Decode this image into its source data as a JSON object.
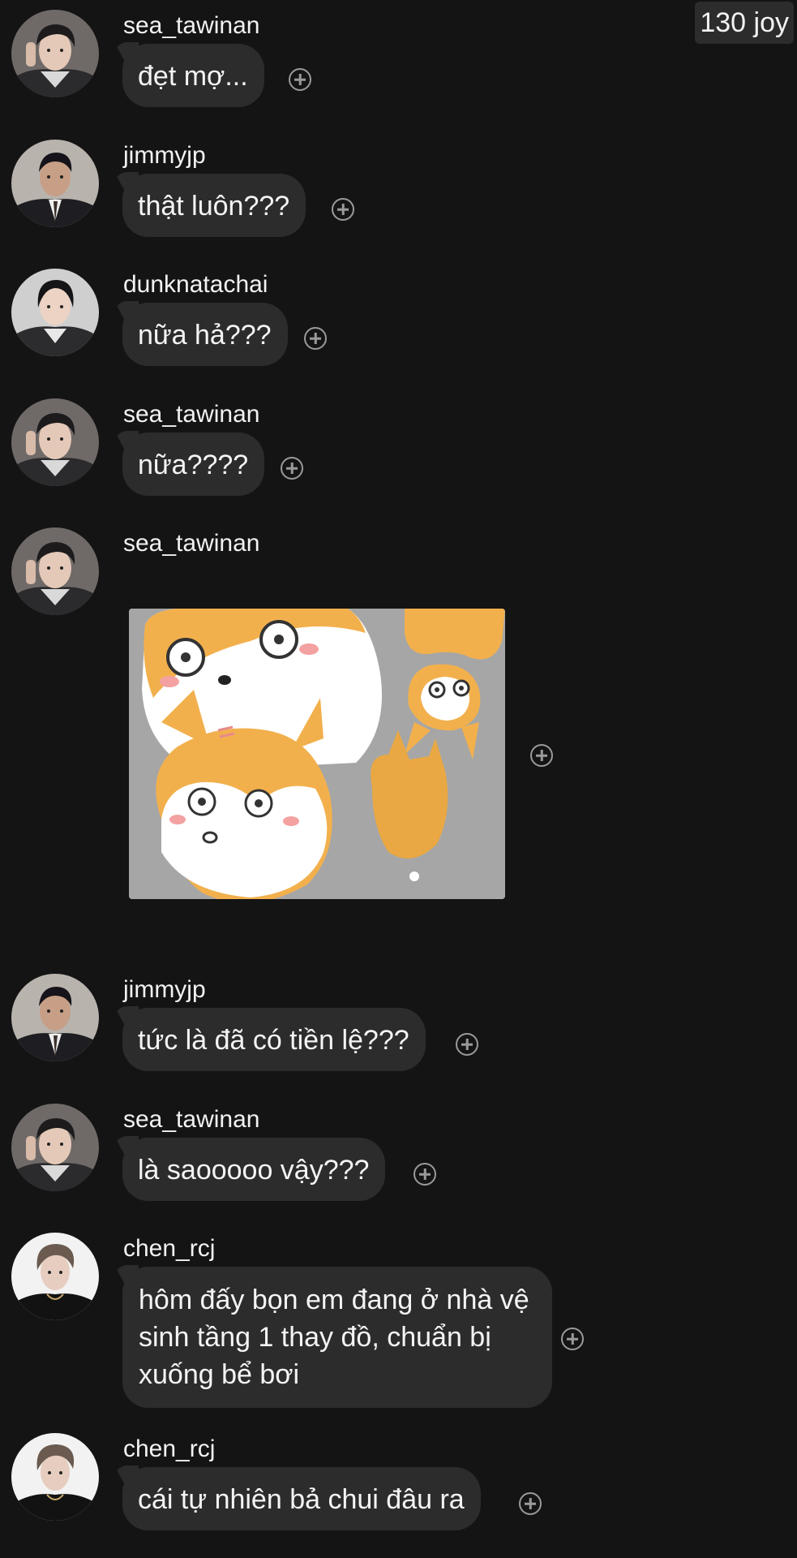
{
  "header": {
    "joy_badge": "130 joy"
  },
  "messages": [
    {
      "user": "sea_tawinan",
      "text": "đẹt mợ...",
      "avatar": "sea-avatar"
    },
    {
      "user": "jimmyjp",
      "text": "thật luôn???",
      "avatar": "jimmy-avatar"
    },
    {
      "user": "dunknatachai",
      "text": "nữa hả???",
      "avatar": "dunk-avatar"
    },
    {
      "user": "sea_tawinan",
      "text": "nữa????",
      "avatar": "sea-avatar"
    },
    {
      "user": "sea_tawinan",
      "sticker": "shiba-dogs-sticker",
      "avatar": "sea-avatar"
    },
    {
      "user": "jimmyjp",
      "text": "tức là đã có tiền lệ???",
      "avatar": "jimmy-avatar"
    },
    {
      "user": "sea_tawinan",
      "text": "là saooooo vậy???",
      "avatar": "sea-avatar"
    },
    {
      "user": "chen_rcj",
      "text": "hôm đấy bọn em đang ở nhà vệ sinh tầng 1 thay đồ, chuẩn bị xuống bể bơi",
      "avatar": "chen-avatar"
    },
    {
      "user": "chen_rcj",
      "text": "cái tự nhiên bả chui đâu ra",
      "avatar": "chen-avatar"
    }
  ],
  "icons": {
    "react": "add-reaction-icon"
  },
  "colors": {
    "background": "#141414",
    "bubble": "#2c2c2c",
    "text": "#f2f2f2",
    "react_icon": "#9a9a9a"
  }
}
